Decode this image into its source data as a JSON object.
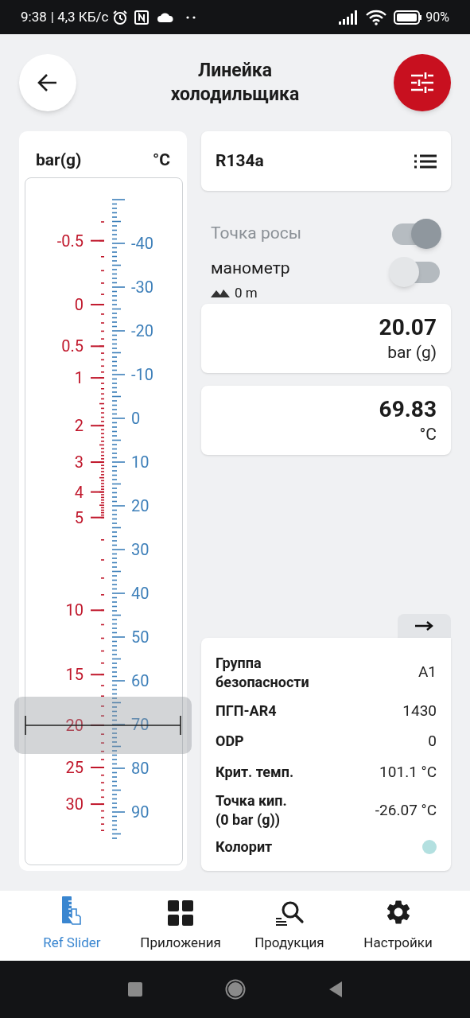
{
  "status_bar": {
    "time": "9:38",
    "network_speed": "| 4,3 КБ/с",
    "battery": "90%"
  },
  "header": {
    "title": "Линейка холодильщика"
  },
  "ruler": {
    "pressure_unit": "bar(g)",
    "temperature_unit": "°C",
    "pressure_labels": [
      "-0.5",
      "0",
      "0.5",
      "1",
      "2",
      "3",
      "4",
      "5",
      "10",
      "15",
      "20",
      "25",
      "30"
    ],
    "temperature_labels": [
      "-40",
      "-30",
      "-20",
      "-10",
      "0",
      "10",
      "20",
      "30",
      "40",
      "50",
      "60",
      "70",
      "80",
      "90"
    ]
  },
  "refrigerant": {
    "name": "R134a"
  },
  "toggles": [
    {
      "label": "Точка росы",
      "on": true,
      "disabled": true
    },
    {
      "label": "манометр",
      "on": false,
      "disabled": false,
      "altitude": "0 m"
    }
  ],
  "readings": [
    {
      "value": "20.07",
      "unit": "bar (g)"
    },
    {
      "value": "69.83",
      "unit": "°C"
    }
  ],
  "properties": [
    {
      "kind": "text",
      "label": "Группа безопасности",
      "value": "A1"
    },
    {
      "kind": "text",
      "label": "ПГП-AR4",
      "value": "1430"
    },
    {
      "kind": "text",
      "label": "ODP",
      "value": "0"
    },
    {
      "kind": "text",
      "label": "Крит. темп.",
      "value": "101.1 °C"
    },
    {
      "kind": "text",
      "label": "Точка кип.\n(0 bar (g))",
      "value": "-26.07 °C"
    },
    {
      "kind": "swatch",
      "label": "Колорит",
      "color": "#b3e0e0"
    }
  ],
  "nav": [
    {
      "label": "Ref Slider",
      "selected": true
    },
    {
      "label": "Приложения",
      "selected": false
    },
    {
      "label": "Продукция",
      "selected": false
    },
    {
      "label": "Настройки",
      "selected": false
    }
  ]
}
